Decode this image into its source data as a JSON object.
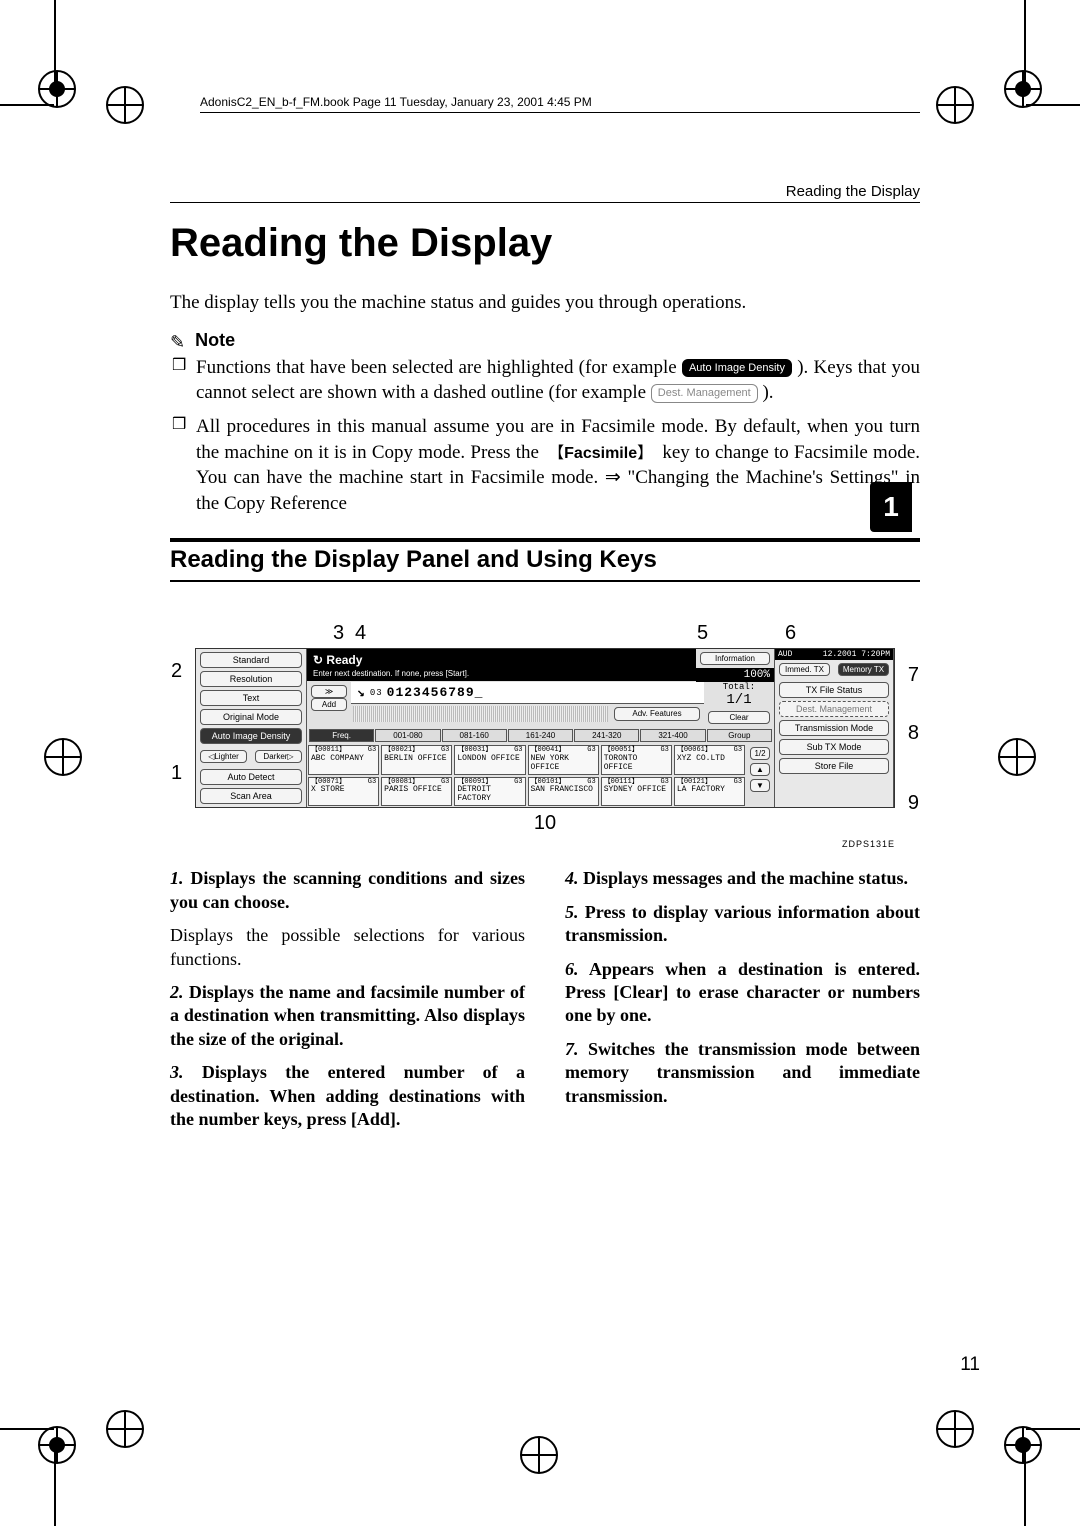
{
  "running_head": "AdonisC2_EN_b-f_FM.book  Page 11  Tuesday, January 23, 2001  4:45 PM",
  "section_head": "Reading the Display",
  "h1": "Reading the Display",
  "intro": "The display tells you the machine status and guides you through operations.",
  "note_label": "Note",
  "note1_a": "Functions that have been selected are highlighted (for example ",
  "note1_chip": "Auto Image Density",
  "note1_b": "). Keys that you cannot select are shown with a dashed outline (for example ",
  "note1_chip2": "Dest. Management",
  "note1_c": ").",
  "note2_a": "All procedures in this manual assume you are in Facsimile mode. By default, when you turn the machine on it is in Copy mode. Press the ",
  "note2_key": "Facsimile",
  "note2_b": " key to change to Facsimile mode. You can have the machine start in Facsimile mode. ⇒ \"Changing the Machine's Settings\" in the Copy Reference",
  "h2": "Reading the Display Panel and Using Keys",
  "thumb": "1",
  "callouts_top": {
    "c3": "3",
    "c4": "4",
    "c5": "5",
    "c6": "6"
  },
  "callouts_side": {
    "c1": "1",
    "c2": "2",
    "c7": "7",
    "c8": "8",
    "c9": "9"
  },
  "callout_bottom": "10",
  "figure_id": "ZDPS131E",
  "panel": {
    "left": {
      "standard": "Standard",
      "resolution": "Resolution",
      "text": "Text",
      "original_mode": "Original Mode",
      "auto_density": "Auto Image Density",
      "lighter": "◁Lighter",
      "darker": "Darker▷",
      "auto_detect": "Auto Detect",
      "scan_area": "Scan Area"
    },
    "mid": {
      "ready": "Ready",
      "ready_icon": "↻",
      "ready_sub": "Enter next destination. If none, press [Start].",
      "add_arrows": "≫",
      "add": "Add",
      "dest_icon": "↘",
      "dest_number": "0123456789_",
      "dest_prefix": "03",
      "total_label": "Total:",
      "total_value": "1/1",
      "adv": "Adv. Features",
      "clear": "Clear",
      "info": "Information",
      "pct": "100%",
      "tabs": {
        "freq": "Freq.",
        "t1": "001-080",
        "t2": "081-160",
        "t3": "161-240",
        "t4": "241-320",
        "t5": "321-400",
        "group": "Group"
      },
      "page": "1/2",
      "up": "▲",
      "down": "▼",
      "row1": [
        {
          "id": "【00011】",
          "n": "G3",
          "name": "ABC COMPANY"
        },
        {
          "id": "【00021】",
          "n": "G3",
          "name": "BERLIN OFFICE"
        },
        {
          "id": "【00031】",
          "n": "G3",
          "name": "LONDON OFFICE"
        },
        {
          "id": "【00041】",
          "n": "G3",
          "name": "NEW YORK OFFICE"
        },
        {
          "id": "【00051】",
          "n": "G3",
          "name": "TORONTO OFFICE"
        },
        {
          "id": "【00061】",
          "n": "G3",
          "name": "XYZ CO.LTD"
        }
      ],
      "row2": [
        {
          "id": "【00071】",
          "n": "G3",
          "name": "X STORE"
        },
        {
          "id": "【00081】",
          "n": "G3",
          "name": "PARIS OFFICE"
        },
        {
          "id": "【00091】",
          "n": "G3",
          "name": "DETROIT FACTORY"
        },
        {
          "id": "【00101】",
          "n": "G3",
          "name": "SAN FRANCISCO"
        },
        {
          "id": "【00111】",
          "n": "G3",
          "name": "SYDNEY OFFICE"
        },
        {
          "id": "【00121】",
          "n": "G3",
          "name": "LA FACTORY"
        }
      ]
    },
    "right": {
      "aud": "AUD",
      "datetime": "12.2001  7:20PM",
      "immed": "Immed. TX",
      "memory": "Memory TX",
      "txfile": "TX File Status",
      "destmgmt": "Dest. Management",
      "transmode": "Transmission Mode",
      "subtx": "Sub TX Mode",
      "store": "Store File"
    }
  },
  "explain": {
    "p1_lead": "1.",
    "p1_bold": " Displays the scanning conditions and sizes you can choose.",
    "p1_body": "Displays the possible selections for various functions.",
    "p2_lead": "2.",
    "p2_bold": " Displays the name and facsimile number of a destination when transmitting. Also displays the size of the original.",
    "p3_lead": "3.",
    "p3_bold": " Displays the entered number of a destination. When adding destinations with the number keys, press [Add].",
    "p4_lead": "4.",
    "p4_bold": " Displays messages and the machine status.",
    "p5_lead": "5.",
    "p5_bold": " Press to display various information about transmission.",
    "p6_lead": "6.",
    "p6_bold_a": " Appears when a destination is entered. Press ",
    "p6_key": "[Clear]",
    "p6_bold_b": " to erase character or numbers one by one.",
    "p7_lead": "7.",
    "p7_bold": " Switches the transmission mode between memory transmission and immediate transmission."
  },
  "page_number": "11"
}
